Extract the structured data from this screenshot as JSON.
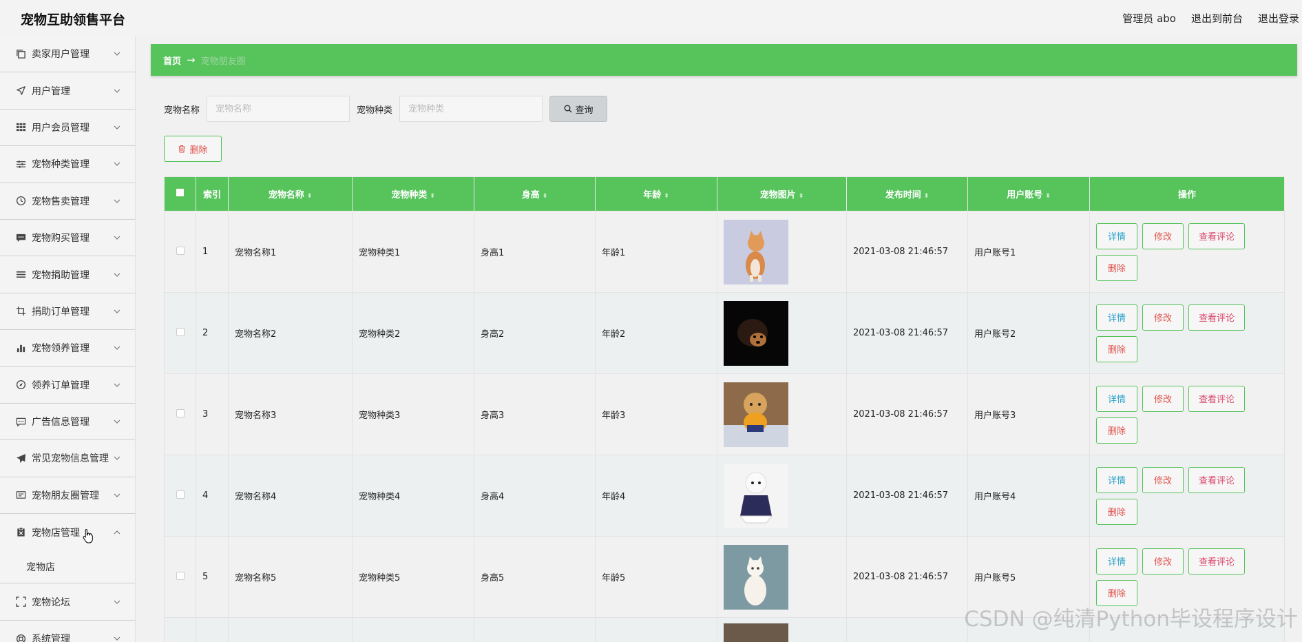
{
  "app": {
    "title": "宠物互助领售平台",
    "admin_label": "管理员 abo",
    "exit_front": "退出到前台",
    "logout": "退出登录"
  },
  "sidebar": {
    "items": [
      {
        "label": "卖家用户管理",
        "icon": "copy-icon"
      },
      {
        "label": "用户管理",
        "icon": "navigation-icon"
      },
      {
        "label": "用户会员管理",
        "icon": "grid-icon"
      },
      {
        "label": "宠物种类管理",
        "icon": "sliders-icon"
      },
      {
        "label": "宠物售卖管理",
        "icon": "clock-icon"
      },
      {
        "label": "宠物购买管理",
        "icon": "chat-icon"
      },
      {
        "label": "宠物捐助管理",
        "icon": "menu-icon"
      },
      {
        "label": "捐助订单管理",
        "icon": "crop-icon"
      },
      {
        "label": "宠物领养管理",
        "icon": "bar-chart-icon"
      },
      {
        "label": "领养订单管理",
        "icon": "compass-icon"
      },
      {
        "label": "广告信息管理",
        "icon": "message-icon"
      },
      {
        "label": "常见宠物信息管理",
        "icon": "send-icon"
      },
      {
        "label": "宠物朋友圈管理",
        "icon": "card-icon"
      },
      {
        "label": "宠物店管理",
        "icon": "clipboard-icon"
      }
    ],
    "sub_item": "宠物店",
    "after_items": [
      {
        "label": "宠物论坛",
        "icon": "fullscreen-icon"
      },
      {
        "label": "系统管理",
        "icon": "lifebuoy-icon"
      }
    ]
  },
  "breadcrumb": {
    "home": "首页",
    "arrow": "→",
    "current": "宠物朋友圈"
  },
  "search": {
    "name_label": "宠物名称",
    "name_placeholder": "宠物名称",
    "type_label": "宠物种类",
    "type_placeholder": "宠物种类",
    "query_button": "查询"
  },
  "toolbar": {
    "delete_label": "删除"
  },
  "table": {
    "headers": [
      "索引",
      "宠物名称",
      "宠物种类",
      "身高",
      "年龄",
      "宠物图片",
      "发布时间",
      "用户账号",
      "操作"
    ],
    "rows": [
      {
        "index": "1",
        "name": "宠物名称1",
        "type": "宠物种类1",
        "height": "身高1",
        "age": "年龄1",
        "time": "2021-03-08 21:46:57",
        "account": "用户账号1"
      },
      {
        "index": "2",
        "name": "宠物名称2",
        "type": "宠物种类2",
        "height": "身高2",
        "age": "年龄2",
        "time": "2021-03-08 21:46:57",
        "account": "用户账号2"
      },
      {
        "index": "3",
        "name": "宠物名称3",
        "type": "宠物种类3",
        "height": "身高3",
        "age": "年龄3",
        "time": "2021-03-08 21:46:57",
        "account": "用户账号3"
      },
      {
        "index": "4",
        "name": "宠物名称4",
        "type": "宠物种类4",
        "height": "身高4",
        "age": "年龄4",
        "time": "2021-03-08 21:46:57",
        "account": "用户账号4"
      },
      {
        "index": "5",
        "name": "宠物名称5",
        "type": "宠物种类5",
        "height": "身高5",
        "age": "年龄5",
        "time": "2021-03-08 21:46:57",
        "account": "用户账号5"
      }
    ],
    "ops": {
      "detail": "详情",
      "edit": "修改",
      "comments": "查看评论",
      "delete": "删除"
    }
  },
  "watermark": "CSDN @纯清Python毕设程序设计",
  "colors": {
    "accent": "#56c35b",
    "detail_text": "#2aa1c9",
    "danger_text": "#e0514b"
  }
}
